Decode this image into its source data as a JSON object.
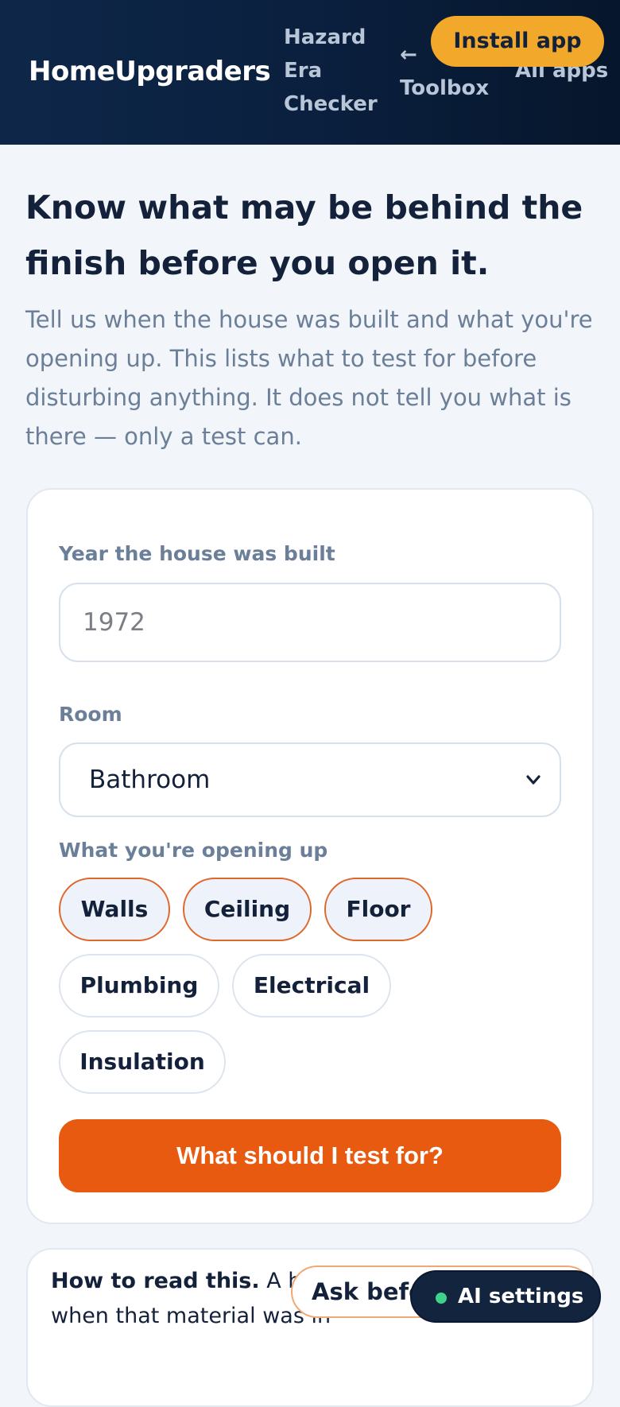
{
  "header": {
    "brand": "HomeUpgraders",
    "current_page": "Hazard Era Checker",
    "toolbox_link": "← Toolbox",
    "all_apps_link": "All apps",
    "install_button": "Install app"
  },
  "hero": {
    "title": "Know what may be behind the finish before you open it.",
    "subtitle": "Tell us when the house was built and what you're opening up. This lists what to test for before disturbing anything. It does not tell you what is there — only a test can."
  },
  "form": {
    "year_label": "Year the house was built",
    "year_placeholder": "1972",
    "year_value": "",
    "room_label": "Room",
    "room_selected": "Bathroom",
    "opening_label": "What you're opening up",
    "options": [
      {
        "label": "Walls",
        "selected": true
      },
      {
        "label": "Ceiling",
        "selected": true
      },
      {
        "label": "Floor",
        "selected": true
      },
      {
        "label": "Plumbing",
        "selected": false
      },
      {
        "label": "Electrical",
        "selected": false
      },
      {
        "label": "Insulation",
        "selected": false
      }
    ],
    "submit_label": "What should I test for?"
  },
  "info": {
    "heading": "How to read this.",
    "text": "A h house is from an era when that material was in"
  },
  "floating": {
    "ask_label": "Ask befo",
    "ai_settings_label": "AI settings",
    "ai_status_color": "#3ed28a"
  },
  "colors": {
    "accent": "#e85a10",
    "install": "#f2a92b",
    "header_bg": "#0a1f3d"
  }
}
